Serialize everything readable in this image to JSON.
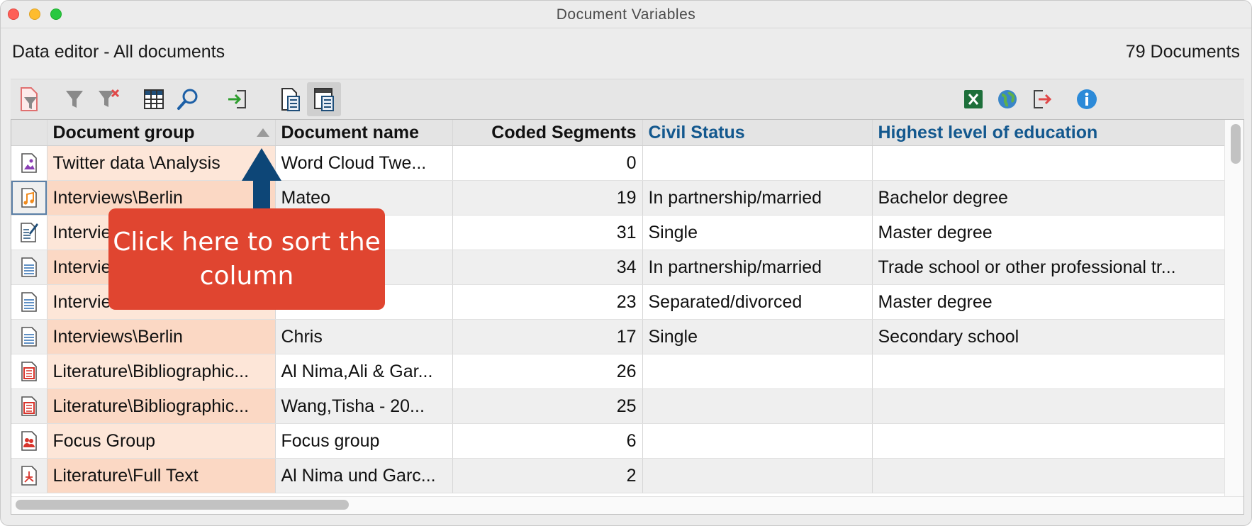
{
  "window": {
    "title": "Document Variables"
  },
  "header": {
    "editor_title": "Data editor - All documents",
    "document_count": "79 Documents"
  },
  "toolbar": {
    "icons": [
      "filter-document-icon",
      "filter-icon",
      "clear-filter-icon",
      "columns-icon",
      "search-icon",
      "import-icon",
      "list-variables-icon",
      "data-editor-icon",
      "excel-export-icon",
      "html-export-icon",
      "export-icon",
      "info-icon"
    ]
  },
  "table": {
    "columns": [
      "Document group",
      "Document name",
      "Coded Segments",
      "Civil Status",
      "Highest level of education"
    ],
    "rows": [
      {
        "icon": "image-document-icon",
        "group": "Twitter data \\Analysis",
        "name": "Word Cloud Twe...",
        "coded": "0",
        "civil": "",
        "education": ""
      },
      {
        "icon": "audio-document-icon",
        "group": "Interviews\\Berlin",
        "name": "Mateo",
        "coded": "19",
        "civil": "In partnership/married",
        "education": "Bachelor degree"
      },
      {
        "icon": "memo-document-icon",
        "group": "Intervie",
        "name": "",
        "coded": "31",
        "civil": "Single",
        "education": "Master degree"
      },
      {
        "icon": "text-document-icon",
        "group": "Intervie",
        "name": "",
        "coded": "34",
        "civil": "In partnership/married",
        "education": "Trade school or other professional tr..."
      },
      {
        "icon": "text-document-icon",
        "group": "Intervie",
        "name": "",
        "coded": "23",
        "civil": "Separated/divorced",
        "education": "Master degree"
      },
      {
        "icon": "text-document-icon",
        "group": "Interviews\\Berlin",
        "name": "Chris",
        "coded": "17",
        "civil": "Single",
        "education": "Secondary school"
      },
      {
        "icon": "bibliography-document-icon",
        "group": "Literature\\Bibliographic...",
        "name": "Al Nima,Ali & Gar...",
        "coded": "26",
        "civil": "",
        "education": ""
      },
      {
        "icon": "bibliography-document-icon",
        "group": "Literature\\Bibliographic...",
        "name": "Wang,Tisha - 20...",
        "coded": "25",
        "civil": "",
        "education": ""
      },
      {
        "icon": "focus-group-icon",
        "group": "Focus Group",
        "name": "Focus group",
        "coded": "6",
        "civil": "",
        "education": ""
      },
      {
        "icon": "pdf-document-icon",
        "group": "Literature\\Full Text",
        "name": "Al Nima und Garc...",
        "coded": "2",
        "civil": "",
        "education": ""
      }
    ]
  },
  "callout": {
    "text": "Click here to sort the column",
    "color": "#e04530"
  },
  "arrow_color": "#0d4677",
  "sort_direction": "ascending"
}
